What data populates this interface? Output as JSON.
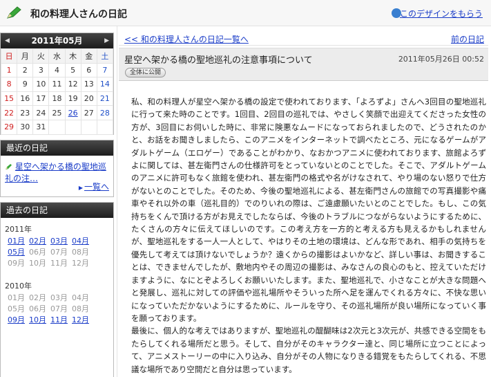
{
  "header": {
    "title": "和の料理人さんの日記",
    "design_link": "このデザインをもらう"
  },
  "calendar": {
    "month_label": "2011年05月",
    "prev_arrow": "◀",
    "next_arrow": "▶",
    "weekdays": [
      "日",
      "月",
      "火",
      "水",
      "木",
      "金",
      "土"
    ],
    "weeks": [
      [
        "1",
        "2",
        "3",
        "4",
        "5",
        "6",
        "7"
      ],
      [
        "8",
        "9",
        "10",
        "11",
        "12",
        "13",
        "14"
      ],
      [
        "15",
        "16",
        "17",
        "18",
        "19",
        "20",
        "21"
      ],
      [
        "22",
        "23",
        "24",
        "25",
        "26",
        "27",
        "28"
      ],
      [
        "29",
        "30",
        "31",
        "",
        "",
        "",
        ""
      ]
    ],
    "linked_day": "26"
  },
  "recent": {
    "heading": "最近の日記",
    "entry": "星空へ架かる橋の聖地巡礼の注…",
    "more_link": "一覧へ"
  },
  "past": {
    "heading": "過去の日記",
    "years": [
      {
        "year": "2011年",
        "months": [
          {
            "label": "01月",
            "link": true
          },
          {
            "label": "02月",
            "link": true
          },
          {
            "label": "03月",
            "link": true
          },
          {
            "label": "04月",
            "link": true
          },
          {
            "label": "05月",
            "link": true
          },
          {
            "label": "06月",
            "link": false
          },
          {
            "label": "07月",
            "link": false
          },
          {
            "label": "08月",
            "link": false
          },
          {
            "label": "09月",
            "link": false
          },
          {
            "label": "10月",
            "link": false
          },
          {
            "label": "11月",
            "link": false
          },
          {
            "label": "12月",
            "link": false
          }
        ]
      },
      {
        "year": "2010年",
        "months": [
          {
            "label": "01月",
            "link": false
          },
          {
            "label": "02月",
            "link": false
          },
          {
            "label": "03月",
            "link": false
          },
          {
            "label": "04月",
            "link": false
          },
          {
            "label": "05月",
            "link": false
          },
          {
            "label": "06月",
            "link": false
          },
          {
            "label": "07月",
            "link": false
          },
          {
            "label": "08月",
            "link": false
          },
          {
            "label": "09月",
            "link": true
          },
          {
            "label": "10月",
            "link": true
          },
          {
            "label": "11月",
            "link": true
          },
          {
            "label": "12月",
            "link": true
          }
        ]
      }
    ]
  },
  "main": {
    "back_link": "<< 和の料理人さんの日記一覧へ",
    "prev_link": "前の日記",
    "entry_title": "星空へ架かる橋の聖地巡礼の注意事項について",
    "entry_date": "2011年05月26日 00:52",
    "visibility": "全体に公開",
    "paragraphs": [
      "私、和の料理人が星空へ架かる橋の設定で使われております、「よろずよ」さんへ3回目の聖地巡礼に行って来た時のことです。1回目、2回目の巡礼では、やさしく笑顔で出迎えてくださった女性の方が、3回目にお伺いした時に、非常に険悪なムードになっておられましたので、どうされたのかと、お話をお聞きしましたら、このアニメをインターネットで調べたところ、元になるゲームがアダルトゲーム（エロゲー）であることがわかり、なおかつアニメに使われております、旅館よろずよに関しては、甚左衛門さんの仕様許可をとっていないとのことでした。そこで、アダルトゲームのアニメに許可もなく旅館を使われ、甚左衛門の格式や名がけなされて、やり場のない怒りで仕方がないとのことでした。そのため、今後の聖地巡礼による、甚左衛門さんの旅館での写真撮影や痛車やそれ以外の車（巡礼目的）でのりいれの際は、ご遠慮願いたいとのことでした。もし、この気持ちをくんで頂ける方がお見えでしたならば、今後のトラブルにつながらないようにするために、たくさんの方々に伝えてほしいのです。この考え方を一方的と考える方も見えるかもしれませんが、聖地巡礼をする一人一人として、やはりその土地の環境は、どんな形であれ、相手の気持ちを優先して考えては頂けないでしょうか？遠くからの撮影はよいかなど、詳しい事は、お聞きすることは、できませんでしたが、敷地内やその周辺の撮影は、みなさんの良心のもと、控えていただけますように、なにとぞよろしくお願いいたします。また、聖地巡礼で、小さなことが大きな問題へと発展し、巡礼に対しての評価や巡礼場所やそういった所へ足を運んでくれる方々に、不快な思いになっていただかないようにするために、ルールを守り、その巡礼場所が良い場所になっていく事を願っております。",
      "最後に、個人的な考えではありますが、聖地巡礼の醍醐味は2次元と3次元が、共感できる空間をもたらしてくれる場所だと思う。そして、自分がそのキャラクター達と、同じ場所に立つことによって、アニメストーリーの中に入り込み、自分がその人物になりきる錯覚をもたらしてくれる、不思議な場所であり空間だと自分は思っています。"
    ]
  },
  "colors": {
    "link": "#1a3cc8",
    "sunday": "#d02020",
    "saturday": "#2050c8",
    "header_bar": "#222222",
    "pencil_green": "#3aa83a"
  },
  "icons": [
    "pencil-icon",
    "design-icon",
    "small-pencil-icon",
    "triangle-right-icon"
  ]
}
